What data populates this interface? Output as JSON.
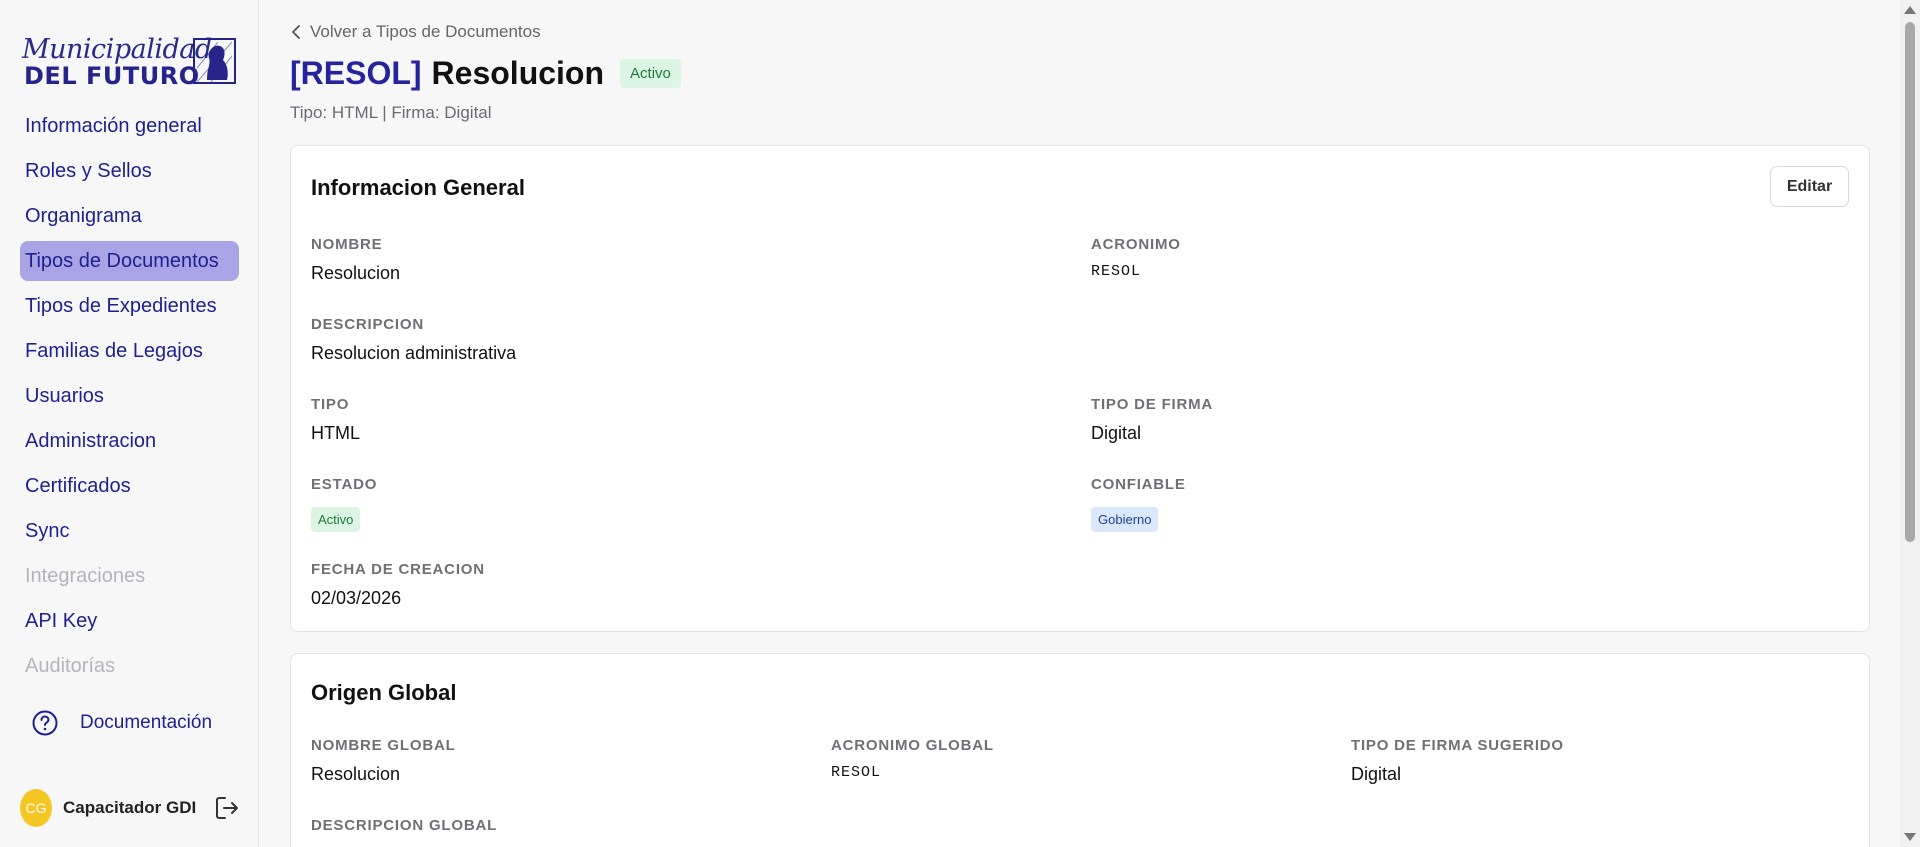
{
  "logo": {
    "line1": "Municipalidad",
    "line2": "DEL FUTURO"
  },
  "sidebar": {
    "items": [
      {
        "label": "Información general",
        "state": "normal"
      },
      {
        "label": "Roles y Sellos",
        "state": "normal"
      },
      {
        "label": "Organigrama",
        "state": "normal"
      },
      {
        "label": "Tipos de Documentos",
        "state": "active"
      },
      {
        "label": "Tipos de Expedientes",
        "state": "normal"
      },
      {
        "label": "Familias de Legajos",
        "state": "normal"
      },
      {
        "label": "Usuarios",
        "state": "normal"
      },
      {
        "label": "Administracion",
        "state": "normal"
      },
      {
        "label": "Certificados",
        "state": "normal"
      },
      {
        "label": "Sync",
        "state": "normal"
      },
      {
        "label": "Integraciones",
        "state": "disabled"
      },
      {
        "label": "API Key",
        "state": "normal"
      },
      {
        "label": "Auditorías",
        "state": "disabled"
      }
    ],
    "documentation_label": "Documentación",
    "documentation_icon": "help-circle-icon",
    "user": {
      "initials": "CG",
      "name": "Capacitador GDI",
      "logout_icon": "logout-icon"
    }
  },
  "header": {
    "back_label": "Volver a Tipos de Documentos",
    "acronym": "[RESOL]",
    "name": "Resolucion",
    "status_badge": "Activo",
    "subtitle": "Tipo: HTML | Firma: Digital"
  },
  "general": {
    "title": "Informacion General",
    "edit_label": "Editar",
    "nombre": {
      "label": "NOMBRE",
      "value": "Resolucion"
    },
    "acronimo": {
      "label": "ACRONIMO",
      "value": "RESOL"
    },
    "descripcion": {
      "label": "DESCRIPCION",
      "value": "Resolucion administrativa"
    },
    "tipo": {
      "label": "TIPO",
      "value": "HTML"
    },
    "tipo_firma": {
      "label": "TIPO DE FIRMA",
      "value": "Digital"
    },
    "estado": {
      "label": "ESTADO",
      "value": "Activo"
    },
    "confiable": {
      "label": "CONFIABLE",
      "value": "Gobierno"
    },
    "fecha": {
      "label": "FECHA DE CREACION",
      "value": "02/03/2026"
    }
  },
  "origen": {
    "title": "Origen Global",
    "nombre": {
      "label": "NOMBRE GLOBAL",
      "value": "Resolucion"
    },
    "acronimo": {
      "label": "ACRONIMO GLOBAL",
      "value": "RESOL"
    },
    "firma": {
      "label": "TIPO DE FIRMA SUGERIDO",
      "value": "Digital"
    },
    "descripcion": {
      "label": "DESCRIPCION GLOBAL"
    }
  },
  "colors": {
    "accent": "#26249a",
    "active_nav": "#a9a4e6",
    "success_bg": "#dcf5e3",
    "info_bg": "#dbe8fb"
  }
}
